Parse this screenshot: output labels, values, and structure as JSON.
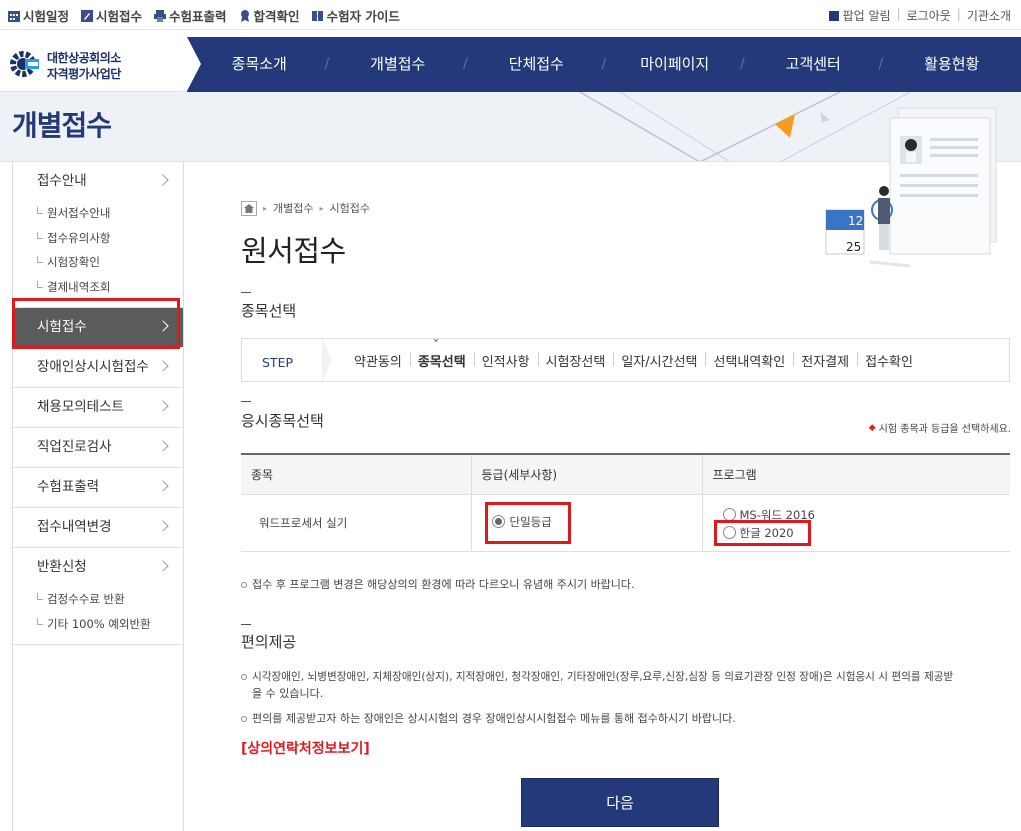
{
  "utility": {
    "left": [
      {
        "label": "시험일정",
        "icon": "calendar-grid-icon"
      },
      {
        "label": "시험접수",
        "icon": "pen-square-icon"
      },
      {
        "label": "수험표출력",
        "icon": "printer-icon"
      },
      {
        "label": "합격확인",
        "icon": "medal-icon"
      },
      {
        "label": "수험자 가이드",
        "icon": "book-icon"
      }
    ],
    "right": [
      "팝업 알림",
      "로그아웃",
      "기관소개"
    ]
  },
  "logo": {
    "line1": "대한상공회의소",
    "line2": "자격평가사업단"
  },
  "nav": [
    "종목소개",
    "개별접수",
    "단체접수",
    "마이페이지",
    "고객센터",
    "활용현황"
  ],
  "banner": {
    "title": "개별접수"
  },
  "illustration": {
    "cal_top": "12",
    "cal_bottom": "25"
  },
  "sidebar": {
    "groups": [
      {
        "label": "접수안내",
        "subs": [
          "원서접수안내",
          "접수유의사항",
          "시험장확인",
          "결제내역조회"
        ]
      },
      {
        "label": "시험접수",
        "active": true,
        "subs": []
      },
      {
        "label": "장애인상시시험접수",
        "subs": []
      },
      {
        "label": "채용모의테스트",
        "subs": []
      },
      {
        "label": "직업진로검사",
        "subs": []
      },
      {
        "label": "수험표출력",
        "subs": []
      },
      {
        "label": "접수내역변경",
        "subs": []
      },
      {
        "label": "반환신청",
        "subs": [
          "검정수수료 반환",
          "기타 100% 예외반환"
        ]
      }
    ]
  },
  "breadcrumb": [
    "개별접수",
    "시험접수"
  ],
  "page_title": "원서접수",
  "section1": "종목선택",
  "steps": {
    "label": "STEP",
    "items": [
      "약관동의",
      "종목선택",
      "인적사항",
      "시험장선택",
      "일자/시간선택",
      "선택내역확인",
      "전자결제",
      "접수확인"
    ],
    "current": 1
  },
  "section2": "응시종목선택",
  "select_note": "시험 종목과 등급을 선택하세요.",
  "table": {
    "headers": [
      "종목",
      "등급(세부사항)",
      "프로그램"
    ],
    "row": {
      "subject": "워드프로세서 실기",
      "grade": "단일등급",
      "programs": [
        "MS-워드 2016",
        "한글 2020"
      ]
    }
  },
  "program_note": "접수 후 프로그램 변경은 해당상의의 환경에 따라 다르오니 유념해 주시기 바랍니다.",
  "section3": "편의제공",
  "conv_notes": [
    "시각장애인, 뇌병변장애인, 지체장애인(상지), 지적장애인, 청각장애인, 기타장애인(장루,요루,신장,심장 등 의료기관장 인정 장애)은 시험응시 시 편의를 제공받",
    "을 수 있습니다.",
    "편의를 제공받고자 하는 장애인은 상시시험의 경우 장애인상시시험접수 메뉴를 통해 접수하시기 바랍니다."
  ],
  "contact_link": "[상의연락처정보보기]",
  "next_button": "다음",
  "colors": {
    "brand": "#24397a",
    "highlight": "#e0191e",
    "active_menu": "#5b5b5b"
  }
}
